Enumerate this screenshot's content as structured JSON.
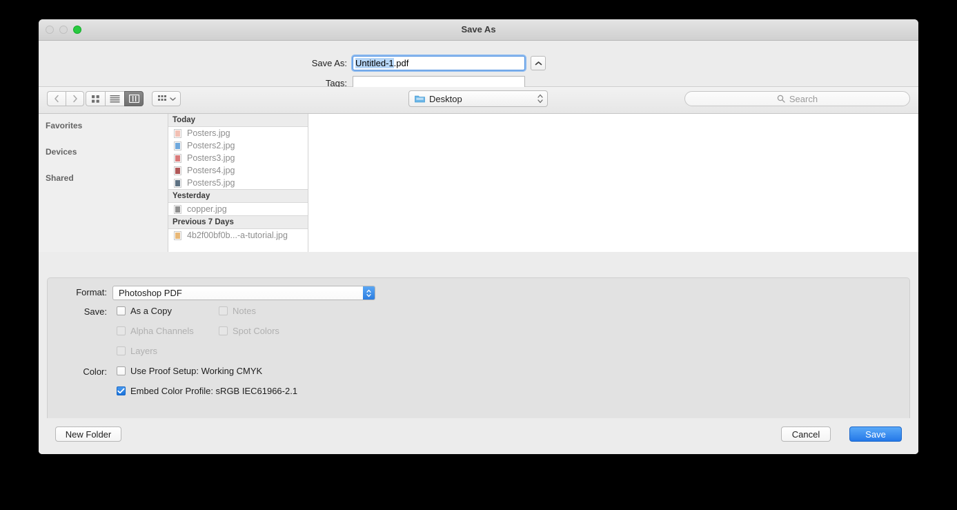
{
  "window": {
    "title": "Save As",
    "traffic_lights": [
      "close-disabled",
      "minimize-disabled",
      "zoom-enabled"
    ]
  },
  "name_area": {
    "saveas_label": "Save As:",
    "saveas_value_selected": "Untitled-1",
    "saveas_value_rest": ".pdf",
    "tags_label": "Tags:",
    "tags_value": "",
    "tags_placeholder": "",
    "disclosure_icon": "chevron-up-icon"
  },
  "toolbar": {
    "back_icon": "chevron-left-icon",
    "forward_icon": "chevron-right-icon",
    "view_icon_grid": "icon-view-icon",
    "view_list": "list-view-icon",
    "view_column": "column-view-icon",
    "view_selected": "column-view-icon",
    "arrange_icon": "arrange-icon",
    "arrange_chevron": "chevron-down-icon",
    "path_label": "Desktop",
    "path_folder_icon": "folder-icon",
    "path_stepper_icon": "stepper-updown-icon",
    "search_placeholder": "Search",
    "search_icon": "search-icon",
    "search_value": ""
  },
  "sidebar": {
    "sections": [
      {
        "label": "Favorites"
      },
      {
        "label": "Devices"
      },
      {
        "label": "Shared"
      }
    ]
  },
  "file_list": {
    "groups": [
      {
        "header": "Today",
        "files": [
          {
            "name": "Posters.jpg",
            "thumb_color": "#f2c0b4"
          },
          {
            "name": "Posters2.jpg",
            "thumb_color": "#6fa8dc"
          },
          {
            "name": "Posters3.jpg",
            "thumb_color": "#d97b7b"
          },
          {
            "name": "Posters4.jpg",
            "thumb_color": "#b05858"
          },
          {
            "name": "Posters5.jpg",
            "thumb_color": "#5d7182"
          }
        ]
      },
      {
        "header": "Yesterday",
        "files": [
          {
            "name": "copper.jpg",
            "thumb_color": "#8f8f8f"
          }
        ]
      },
      {
        "header": "Previous 7 Days",
        "files": [
          {
            "name": "4b2f00bf0b...-a-tutorial.jpg",
            "thumb_color": "#e8b878"
          }
        ]
      }
    ]
  },
  "options": {
    "format_label": "Format:",
    "format_value": "Photoshop PDF",
    "save_label": "Save:",
    "color_label": "Color:",
    "save_checkboxes": [
      {
        "label": "As a Copy",
        "checked": false,
        "enabled": true
      },
      {
        "label": "Notes",
        "checked": false,
        "enabled": false
      },
      {
        "label": "Alpha Channels",
        "checked": false,
        "enabled": false
      },
      {
        "label": "Spot Colors",
        "checked": false,
        "enabled": false
      },
      {
        "label": "Layers",
        "checked": false,
        "enabled": false
      }
    ],
    "color_checkboxes": [
      {
        "label": "Use Proof Setup:  Working CMYK",
        "checked": false,
        "enabled": true
      },
      {
        "label": "Embed Color Profile:  sRGB IEC61966-2.1",
        "checked": true,
        "enabled": true
      }
    ]
  },
  "buttons": {
    "new_folder": "New Folder",
    "cancel": "Cancel",
    "save": "Save"
  },
  "colors": {
    "accent": "#2478e8",
    "selection": "#b6d6f7",
    "window_bg": "#ececec",
    "green_light": "#28c940"
  }
}
